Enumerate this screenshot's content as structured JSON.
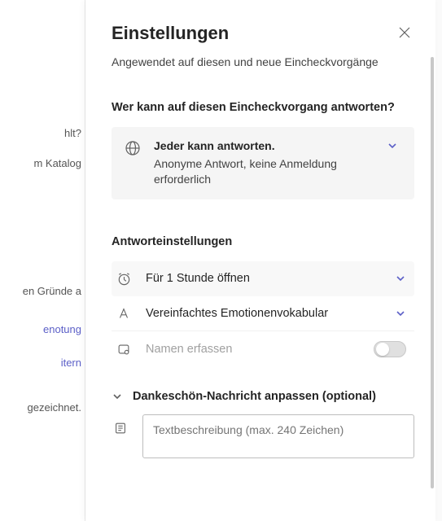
{
  "backdrop": {
    "line1": "hlt?",
    "line2": "m Katalog",
    "line3": "en Gründe a",
    "line4": "enotung",
    "line5": "itern",
    "line6": "gezeichnet."
  },
  "panel": {
    "title": "Einstellungen",
    "subtitle": "Angewendet auf diesen und neue Eincheckvorgänge",
    "who_heading": "Wer kann auf diesen Eincheckvorgang antworten?",
    "respond": {
      "strong": "Jeder kann antworten.",
      "desc": "Anonyme Antwort, keine Anmeldung erforderlich"
    },
    "answer_heading": "Antworteinstellungen",
    "row_duration": "Für 1 Stunde öffnen",
    "row_vocab": "Vereinfachtes Emotionenvokabular",
    "row_names": "Namen erfassen",
    "thanks_label": "Dankeschön-Nachricht anpassen (optional)",
    "textarea_placeholder": "Textbeschreibung (max. 240 Zeichen)"
  }
}
